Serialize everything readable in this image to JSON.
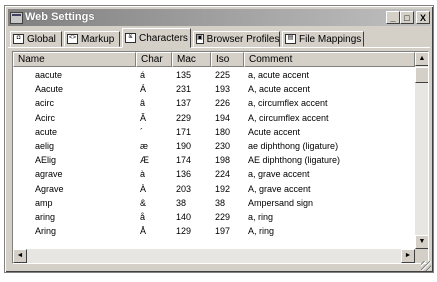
{
  "window": {
    "title": "Web Settings",
    "controls": {
      "minimize": "_",
      "maximize": "□",
      "close": "X"
    }
  },
  "tabs": [
    {
      "label": "Global",
      "icon": "global-icon"
    },
    {
      "label": "Markup",
      "icon": "markup-icon"
    },
    {
      "label": "Characters",
      "icon": "characters-icon",
      "active": true
    },
    {
      "label": "Browser Profiles",
      "icon": "browser-profiles-icon"
    },
    {
      "label": "File Mappings",
      "icon": "file-mappings-icon"
    }
  ],
  "table": {
    "columns": [
      "Name",
      "Char",
      "Mac",
      "Iso",
      "Comment"
    ],
    "rows": [
      [
        "aacute",
        "á",
        "135",
        "225",
        "a, acute accent"
      ],
      [
        "Aacute",
        "Á",
        "231",
        "193",
        "A, acute accent"
      ],
      [
        "acirc",
        "â",
        "137",
        "226",
        "a, circumflex accent"
      ],
      [
        "Acirc",
        "Â",
        "229",
        "194",
        "A, circumflex accent"
      ],
      [
        "acute",
        "´",
        "171",
        "180",
        "Acute accent"
      ],
      [
        "aelig",
        "æ",
        "190",
        "230",
        "ae diphthong (ligature)"
      ],
      [
        "AElig",
        "Æ",
        "174",
        "198",
        "AE diphthong (ligature)"
      ],
      [
        "agrave",
        "à",
        "136",
        "224",
        "a, grave accent"
      ],
      [
        "Agrave",
        "À",
        "203",
        "192",
        "A, grave accent"
      ],
      [
        "amp",
        "&",
        "38",
        "38",
        "Ampersand sign"
      ],
      [
        "aring",
        "å",
        "140",
        "229",
        "a, ring"
      ],
      [
        "Aring",
        "Å",
        "129",
        "197",
        "A, ring"
      ]
    ]
  },
  "scroll": {
    "up": "▲",
    "down": "▼",
    "left": "◄",
    "right": "►"
  }
}
